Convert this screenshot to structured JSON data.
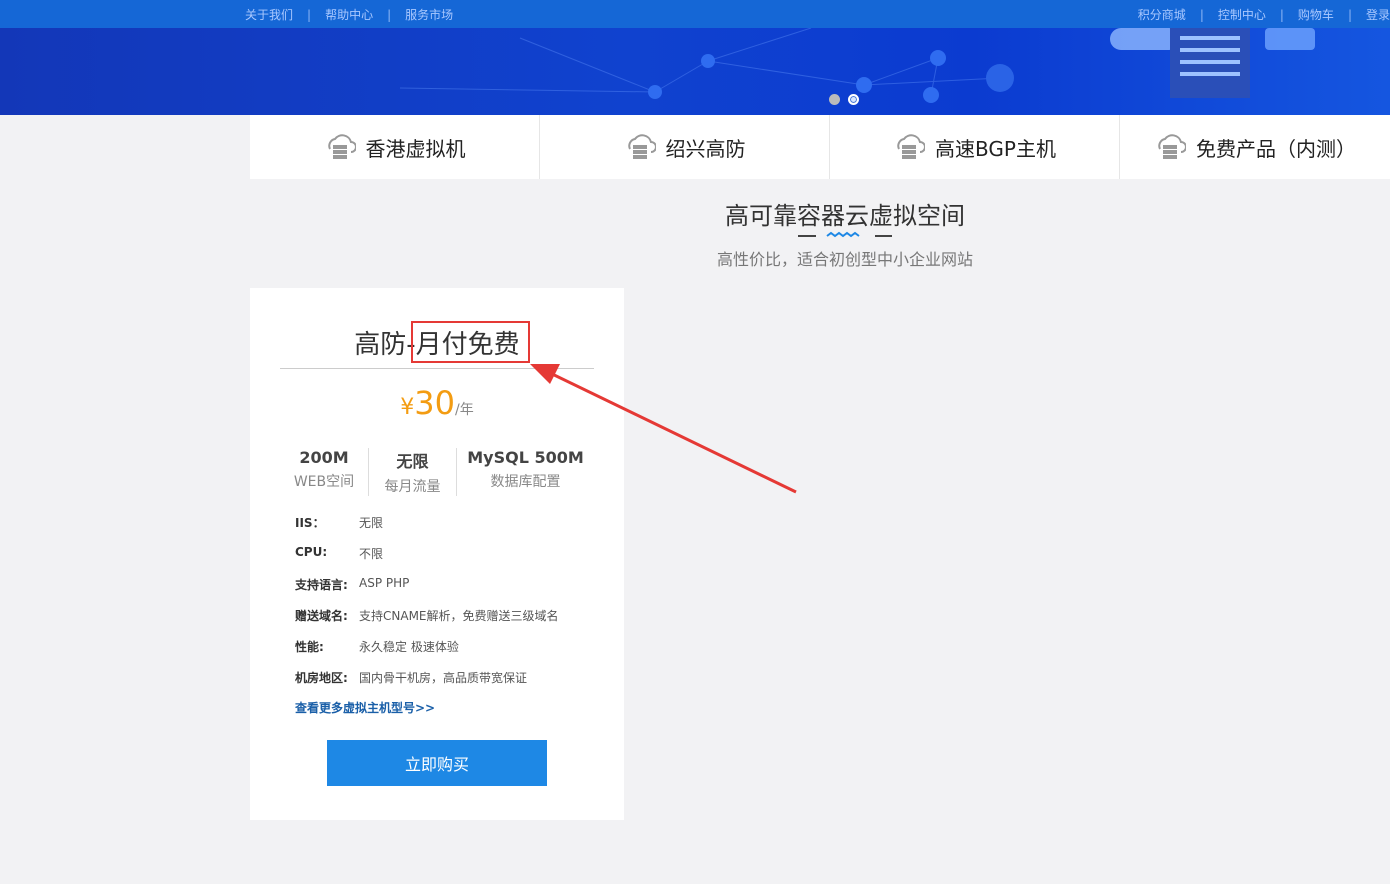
{
  "topbar": {
    "left_links": [
      "关于我们",
      "帮助中心",
      "服务市场"
    ],
    "right_links": [
      "积分商城",
      "控制中心",
      "购物车",
      "登录"
    ],
    "separator": "|"
  },
  "carousel": {
    "slide_count": 2,
    "active_index": 1
  },
  "tabs": [
    {
      "label": "香港虚拟机",
      "icon": "cloud-server-icon"
    },
    {
      "label": "绍兴高防",
      "icon": "cloud-server-icon"
    },
    {
      "label": "高速BGP主机",
      "icon": "cloud-server-icon"
    },
    {
      "label": "免费产品（内测）",
      "icon": "cloud-server-icon"
    }
  ],
  "section": {
    "title": "高可靠容器云虚拟空间",
    "subtitle": "高性价比，适合初创型中小企业网站"
  },
  "card": {
    "title": "高防-月付免费",
    "price": {
      "currency": "¥",
      "amount": "30",
      "unit": "/年"
    },
    "specs": [
      {
        "value": "200M",
        "label": "WEB空间"
      },
      {
        "value": "无限",
        "label": "每月流量"
      },
      {
        "value": "MySQL 500M",
        "label": "数据库配置"
      }
    ],
    "details": [
      {
        "key": "IIS：",
        "value": "无限"
      },
      {
        "key": "CPU:",
        "value": "不限"
      },
      {
        "key": "支持语言:",
        "value": "ASP PHP"
      },
      {
        "key": "赠送域名:",
        "value": "支持CNAME解析，免费赠送三级域名"
      },
      {
        "key": "性能:",
        "value": "永久稳定 极速体验"
      },
      {
        "key": "机房地区:",
        "value": "国内骨干机房，高品质带宽保证"
      }
    ],
    "more_link": "查看更多虚拟主机型号>>",
    "buy_button": "立即购买"
  },
  "colors": {
    "topbar": "#1567d6",
    "banner": "#1042cf",
    "price": "#f39c12",
    "button": "#1e88e5",
    "annotation": "#e53935"
  }
}
